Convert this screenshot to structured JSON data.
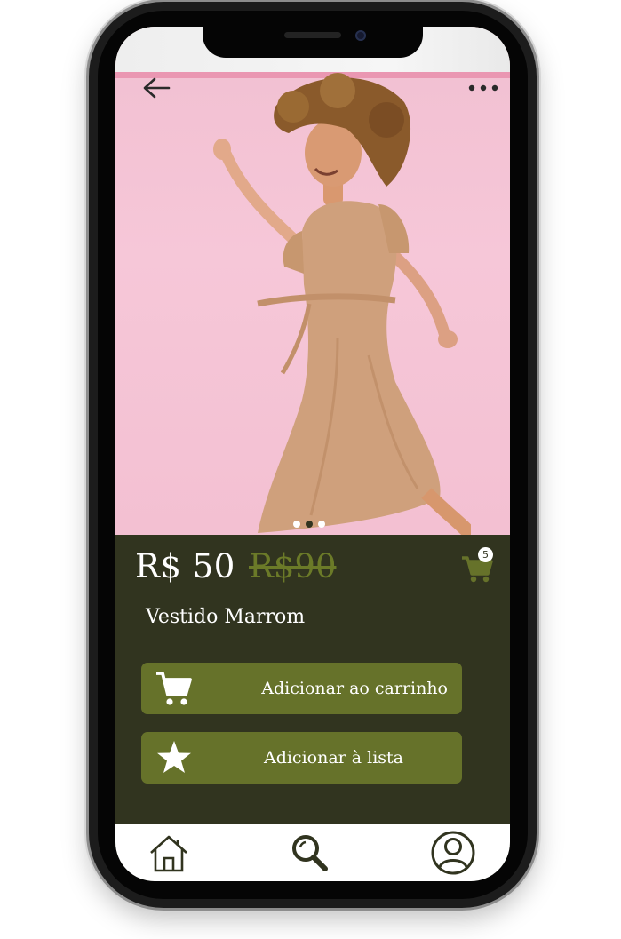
{
  "product": {
    "price": "R$ 50",
    "old_price": "R$90",
    "name": "Vestido Marrom",
    "image_slide_count": 3,
    "active_slide": 2
  },
  "cart": {
    "badge_count": "5"
  },
  "actions": {
    "add_to_cart_label": "Adicionar ao carrinho",
    "add_to_list_label": "Adicionar à lista"
  },
  "colors": {
    "panel_background": "#31341f",
    "accent_olive": "#66722a",
    "old_price": "#6b7a28",
    "photo_background": "#f3c0d2",
    "nav_background": "#ffffff",
    "nav_icon": "#31341f"
  },
  "icons": {
    "back": "arrow-left-icon",
    "more": "more-dots-icon",
    "cart": "cart-icon",
    "star": "star-icon",
    "home": "home-icon",
    "search": "search-icon",
    "profile": "user-icon"
  }
}
